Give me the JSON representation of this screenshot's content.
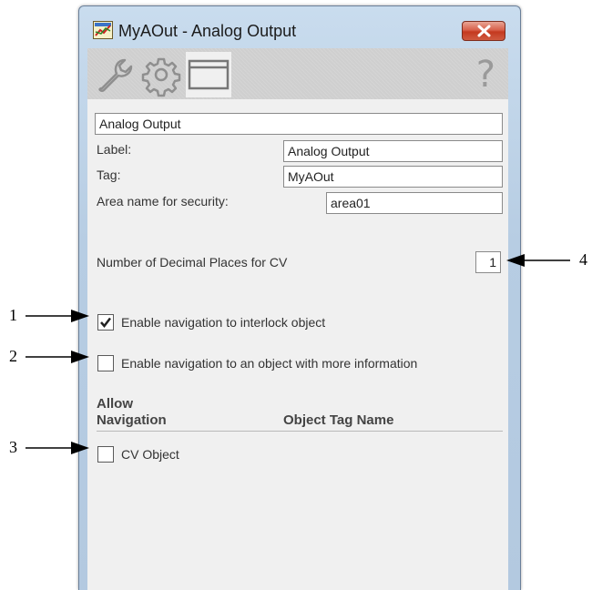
{
  "window": {
    "title": "MyAOut - Analog Output"
  },
  "tabs": [
    {
      "name": "wrench-tab",
      "active": false
    },
    {
      "name": "gear-tab",
      "active": false
    },
    {
      "name": "display-tab",
      "active": true
    }
  ],
  "form": {
    "description_value": "Analog Output",
    "label_caption": "Label:",
    "label_value": "Analog Output",
    "tag_caption": "Tag:",
    "tag_value": "MyAOut",
    "area_caption": "Area name for security:",
    "area_value": "area01",
    "decimal_caption": "Number of Decimal Places for CV",
    "decimal_value": "1",
    "interlock_nav_label": "Enable navigation to interlock object",
    "interlock_nav_checked": true,
    "info_nav_label": "Enable navigation to an object with more information",
    "info_nav_checked": false
  },
  "nav_table": {
    "col1_line1": "Allow",
    "col1_line2": "Navigation",
    "col2": "Object Tag Name",
    "rows": [
      {
        "label": "CV Object",
        "checked": false
      }
    ]
  },
  "callouts": [
    "1",
    "2",
    "3",
    "4"
  ],
  "colors": {
    "frame": "#b7cde3",
    "close_button": "#c4391f",
    "content_bg": "#f0f0f0"
  }
}
